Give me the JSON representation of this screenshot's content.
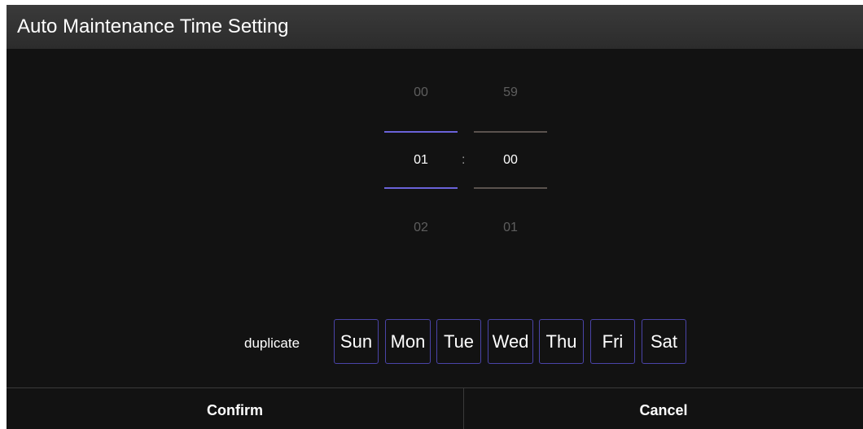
{
  "dialog": {
    "title": "Auto Maintenance Time Setting"
  },
  "time_picker": {
    "hour": {
      "previous": "00",
      "selected": "01",
      "next": "02"
    },
    "separator": ":",
    "minute": {
      "previous": "59",
      "selected": "00",
      "next": "01"
    }
  },
  "repeat": {
    "label": "duplicate",
    "days": [
      "Sun",
      "Mon",
      "Tue",
      "Wed",
      "Thu",
      "Fri",
      "Sat"
    ]
  },
  "actions": {
    "confirm_label": "Confirm",
    "cancel_label": "Cancel"
  },
  "colors": {
    "background": "#121212",
    "titlebar": "#333333",
    "hour_accent": "#6a62d8",
    "minute_accent": "#5a524e",
    "day_border": "#4a44a8"
  }
}
